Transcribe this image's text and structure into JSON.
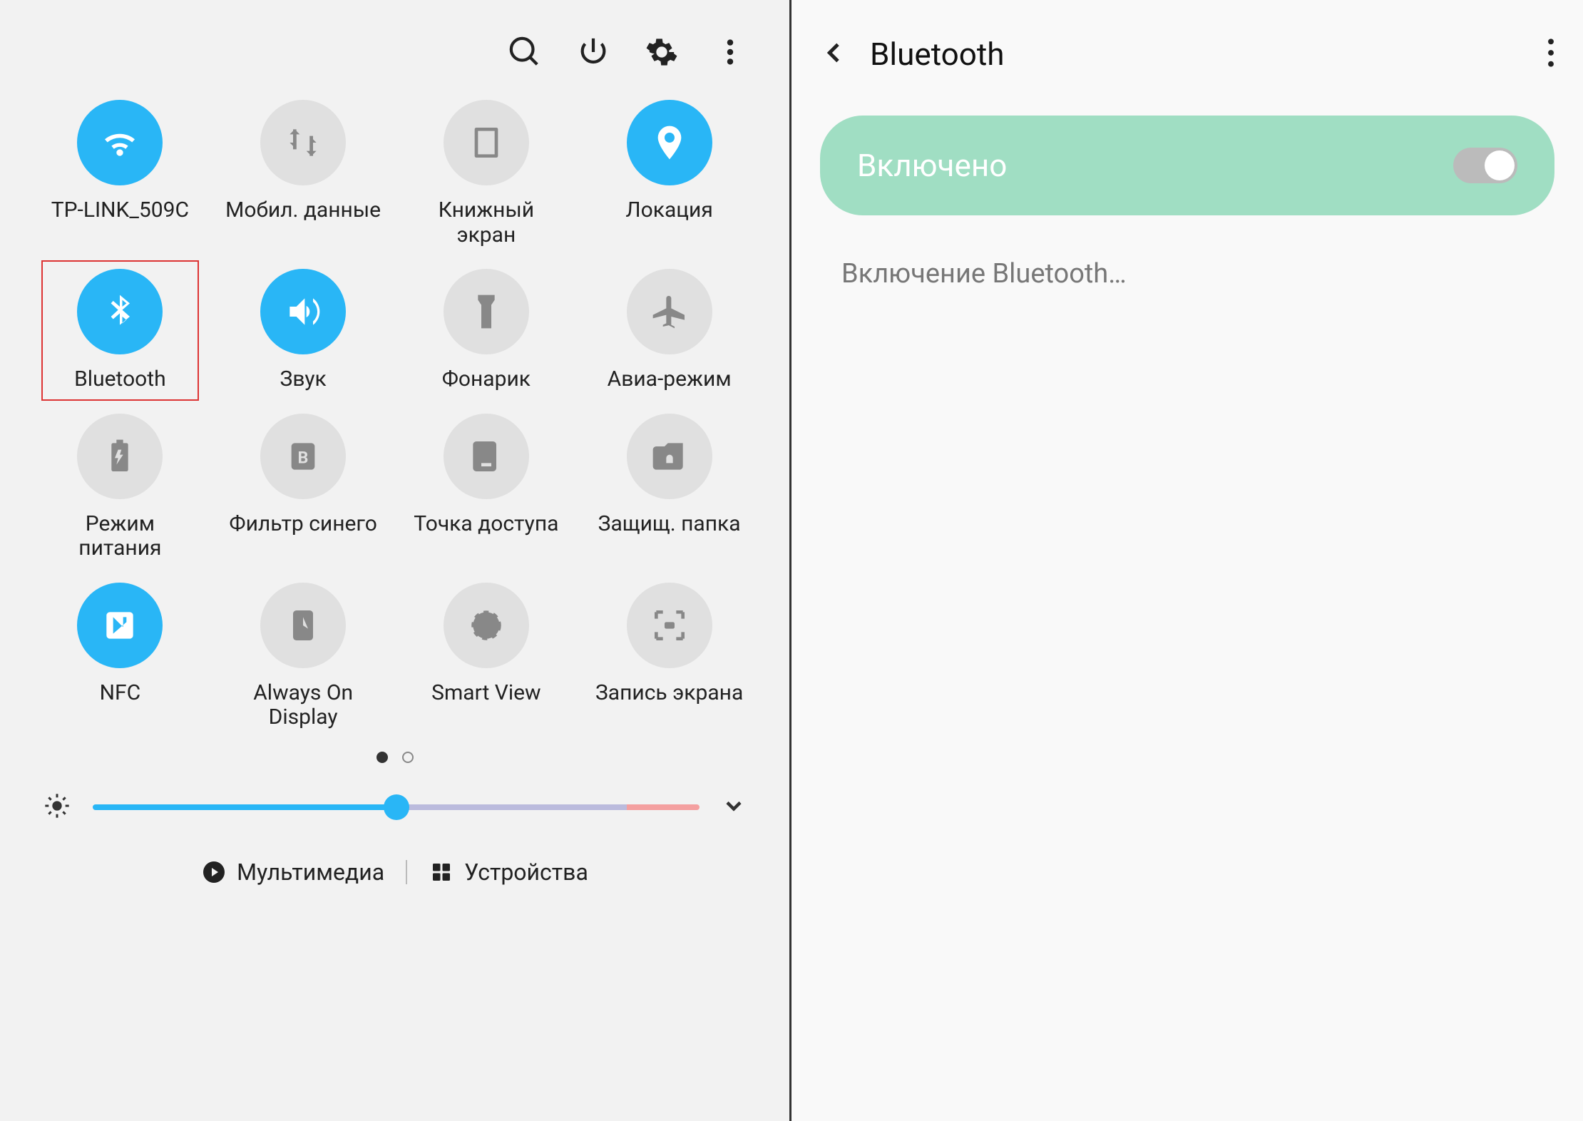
{
  "qs": {
    "tiles": [
      {
        "id": "wifi",
        "label": "TP-LINK_509C",
        "active": true
      },
      {
        "id": "data",
        "label": "Мобил. данные",
        "active": false
      },
      {
        "id": "book",
        "label": "Книжный экран",
        "active": false
      },
      {
        "id": "location",
        "label": "Локация",
        "active": true
      },
      {
        "id": "bluetooth",
        "label": "Bluetooth",
        "active": true,
        "highlighted": true
      },
      {
        "id": "sound",
        "label": "Звук",
        "active": true
      },
      {
        "id": "torch",
        "label": "Фонарик",
        "active": false
      },
      {
        "id": "airplane",
        "label": "Авиа-режим",
        "active": false
      },
      {
        "id": "power",
        "label": "Режим питания",
        "active": false
      },
      {
        "id": "bluefilter",
        "label": "Фильтр синего",
        "active": false
      },
      {
        "id": "hotspot",
        "label": "Точка доступа",
        "active": false
      },
      {
        "id": "secure",
        "label": "Защищ. папка",
        "active": false
      },
      {
        "id": "nfc",
        "label": "NFC",
        "active": true
      },
      {
        "id": "aod",
        "label": "Always On Display",
        "active": false
      },
      {
        "id": "smartview",
        "label": "Smart View",
        "active": false
      },
      {
        "id": "record",
        "label": "Запись экрана",
        "active": false
      }
    ],
    "page_index": 0,
    "page_count": 2,
    "brightness_pct": 50,
    "bottom": {
      "media": "Мультимедиа",
      "devices": "Устройства"
    }
  },
  "bt": {
    "title": "Bluetooth",
    "toggle_label": "Включено",
    "toggle_on": true,
    "status": "Включение Bluetooth…"
  }
}
